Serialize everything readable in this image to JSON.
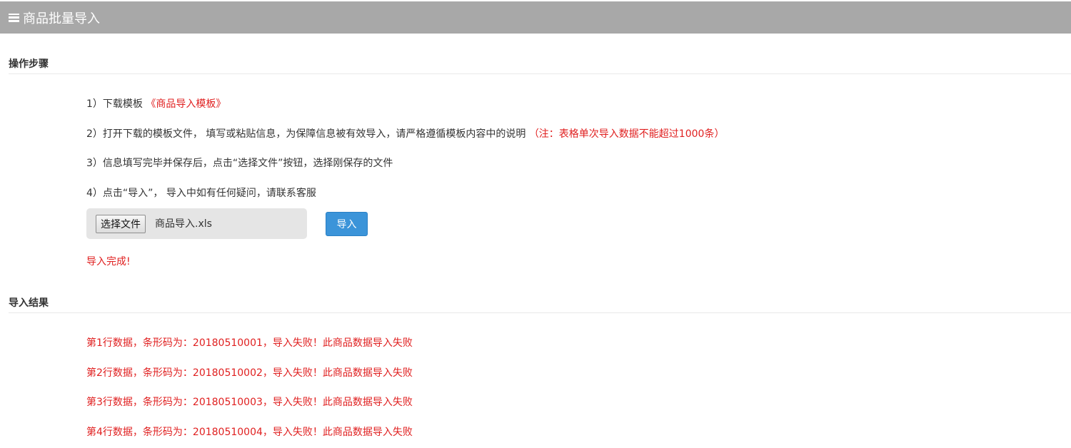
{
  "title": {
    "icon": "hamburger-icon",
    "text": "商品批量导入"
  },
  "steps_section": {
    "heading": "操作步骤",
    "steps": [
      {
        "text": "1）下载模板 ",
        "highlight": "《商品导入模板》"
      },
      {
        "text": "2）打开下载的模板文件， 填写或粘贴信息，为保障信息被有效导入，请严格遵循模板内容中的说明 ",
        "highlight": "（注：表格单次导入数据不能超过1000条）"
      },
      {
        "text": "3）信息填写完毕并保存后，点击“选择文件”按钮，选择刚保存的文件",
        "highlight": ""
      },
      {
        "text": "4）点击“导入”， 导入中如有任何疑问，请联系客服",
        "highlight": ""
      }
    ]
  },
  "upload": {
    "choose_label": "选择文件",
    "file_name": "商品导入.xls",
    "import_label": "导入"
  },
  "status_message": "导入完成!",
  "results_section": {
    "heading": "导入结果",
    "rows": [
      "第1行数据，条形码为：20180510001，导入失败！此商品数据导入失败",
      "第2行数据，条形码为：20180510002，导入失败！此商品数据导入失败",
      "第3行数据，条形码为：20180510003，导入失败！此商品数据导入失败",
      "第4行数据，条形码为：20180510004，导入失败！此商品数据导入失败"
    ]
  },
  "colors": {
    "titlebar": "#a8a8a8",
    "accent_red": "#e02020",
    "button_blue": "#3b94d9"
  }
}
